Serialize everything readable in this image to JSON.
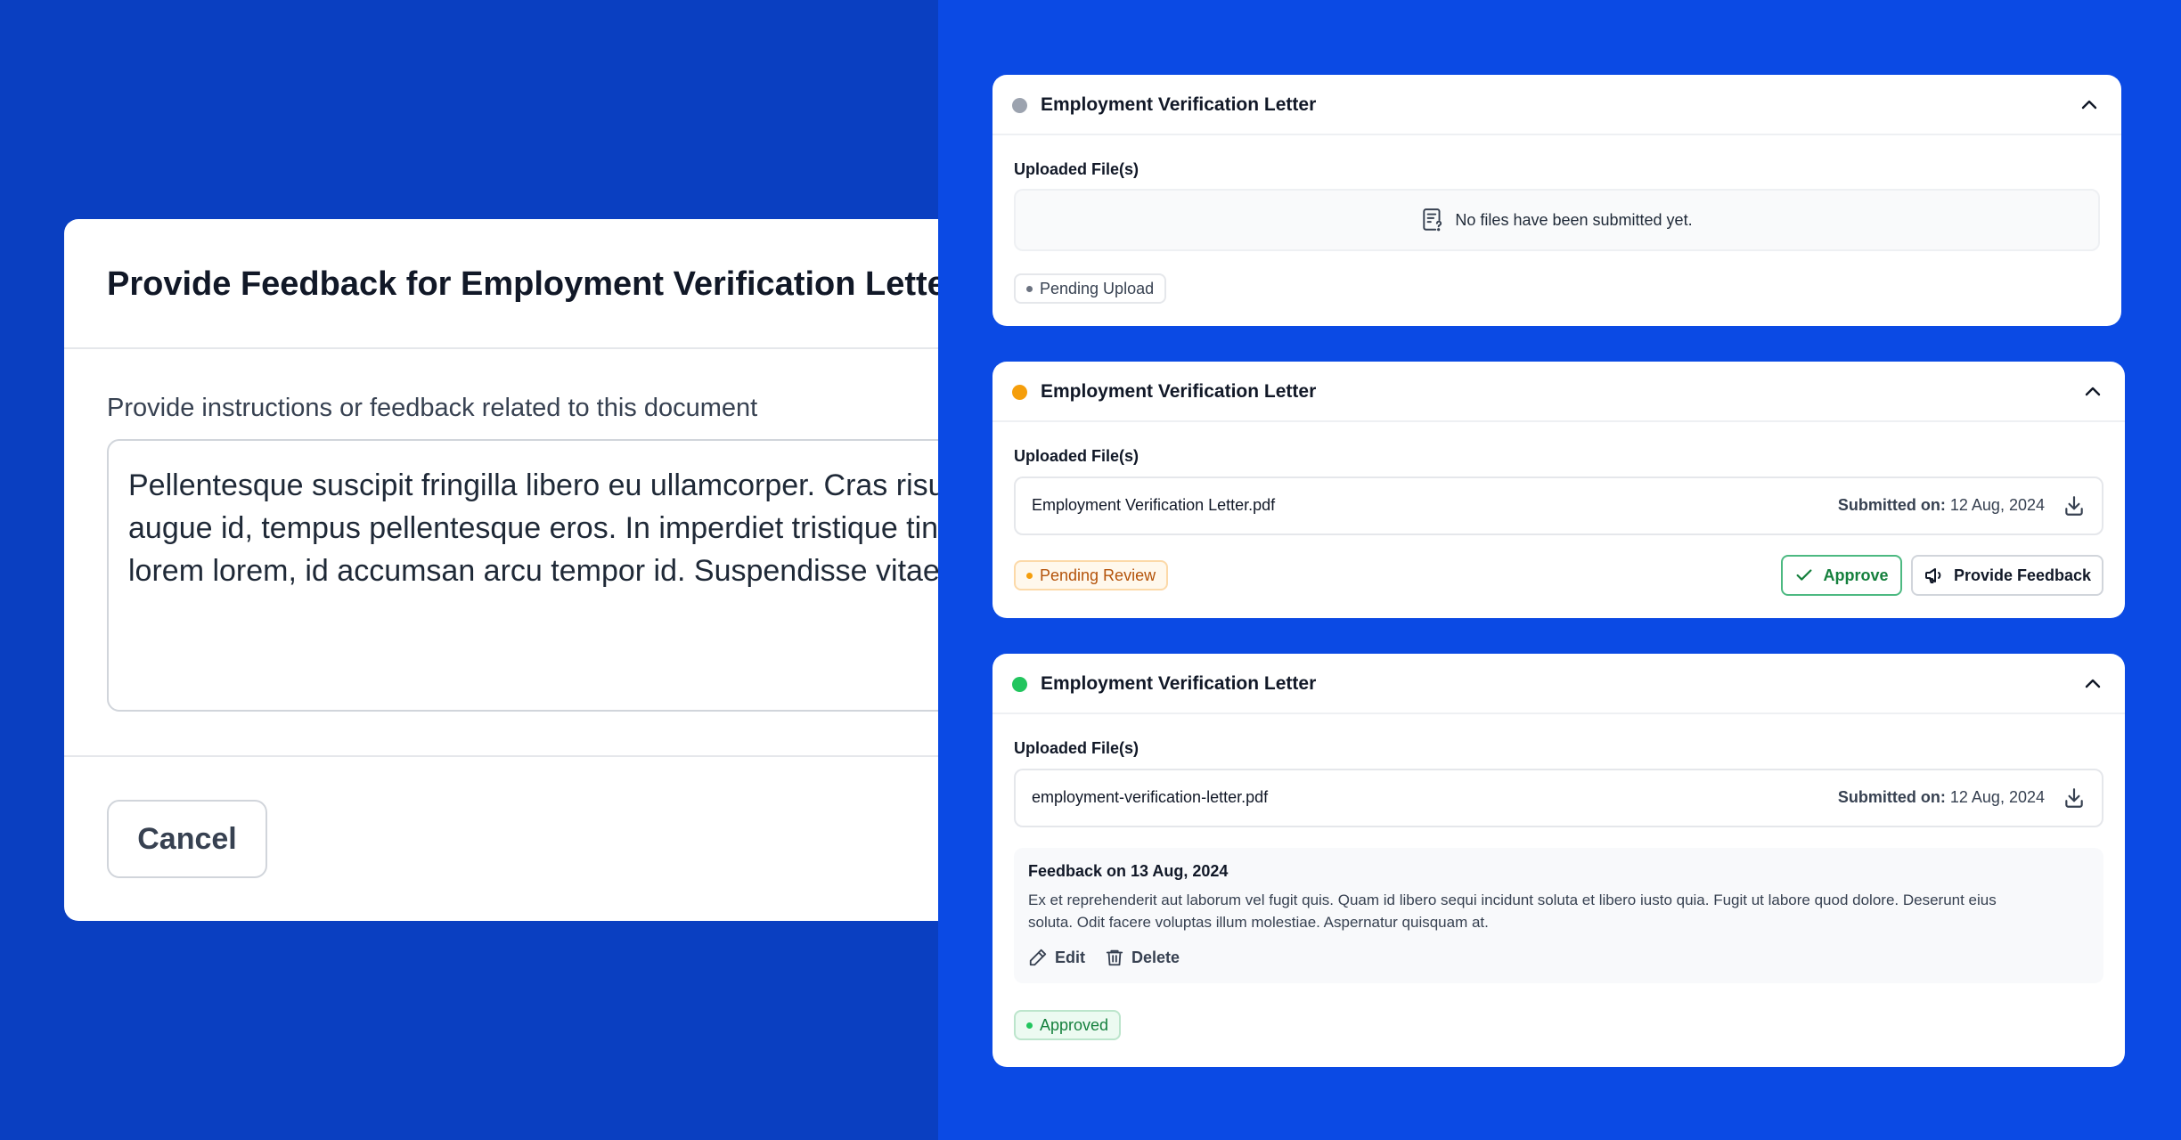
{
  "modal": {
    "title": "Provide Feedback for Employment Verification Letter",
    "field_label": "Provide instructions or feedback related to this document",
    "textarea_lines": [
      "Pellentesque suscipit fringilla libero eu ullamcorper. Cras risus",
      "augue id, tempus pellentesque eros. In imperdiet tristique tinc",
      "lorem lorem, id accumsan arcu tempor id. Suspendisse vitae"
    ],
    "cancel_label": "Cancel"
  },
  "cards": [
    {
      "title": "Employment Verification Letter",
      "status_color": "#9ca3af",
      "uploaded_label": "Uploaded File(s)",
      "empty_text": "No files have been submitted yet.",
      "status": "Pending Upload"
    },
    {
      "title": "Employment Verification Letter",
      "status_color": "#f59e0b",
      "uploaded_label": "Uploaded File(s)",
      "file_name": "Employment Verification Letter.pdf",
      "submitted_label": "Submitted on:",
      "submitted_date": "12 Aug, 2024",
      "status": "Pending Review",
      "approve_label": "Approve",
      "feedback_label": "Provide Feedback"
    },
    {
      "title": "Employment Verification Letter",
      "status_color": "#22c55e",
      "uploaded_label": "Uploaded File(s)",
      "file_name": "employment-verification-letter.pdf",
      "submitted_label": "Submitted on:",
      "submitted_date": "12 Aug, 2024",
      "feedback_title": "Feedback on 13 Aug, 2024",
      "feedback_lines": [
        "Ex et reprehenderit aut laborum vel fugit quis. Quam id libero sequi incidunt soluta et libero iusto quia. Fugit ut labore quod dolore. Deserunt eius",
        "soluta. Odit facere voluptas illum molestiae. Aspernatur quisquam at."
      ],
      "edit_label": "Edit",
      "delete_label": "Delete",
      "status": "Approved"
    }
  ]
}
